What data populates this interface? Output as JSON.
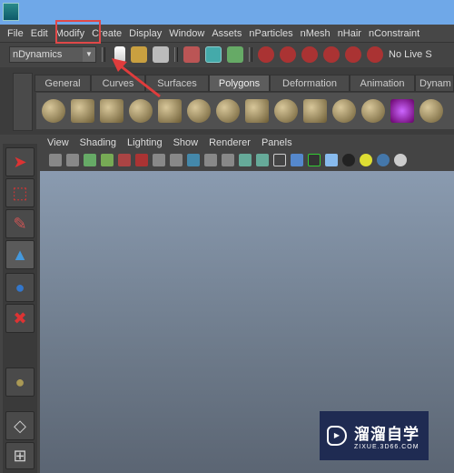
{
  "menu": [
    "File",
    "Edit",
    "Modify",
    "Create",
    "Display",
    "Window",
    "Assets",
    "nParticles",
    "nMesh",
    "nHair",
    "nConstraint"
  ],
  "toolbar": {
    "module": "nDynamics",
    "live": "No Live S"
  },
  "shelf_tabs": [
    "General",
    "Curves",
    "Surfaces",
    "Polygons",
    "Deformation",
    "Animation",
    "Dynam"
  ],
  "active_tab": "Polygons",
  "panel_menu": [
    "View",
    "Shading",
    "Lighting",
    "Show",
    "Renderer",
    "Panels"
  ],
  "watermark": {
    "title": "溜溜自学",
    "url": "ZIXUE.3D66.COM"
  },
  "colors": {
    "highlight": "#e04848",
    "titlebar": "#6fa8e8"
  }
}
